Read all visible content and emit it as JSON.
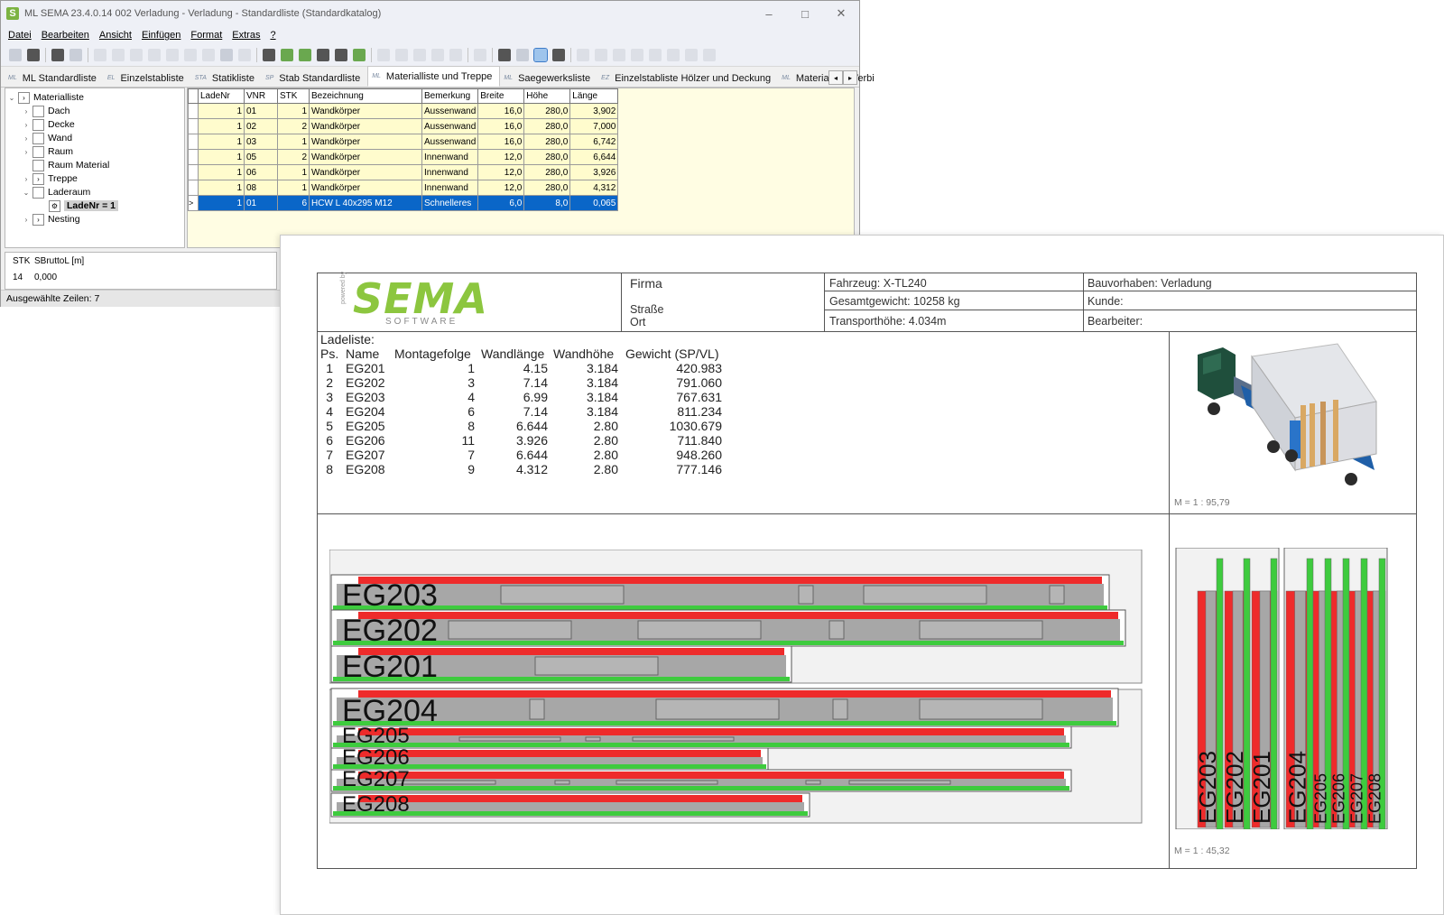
{
  "window": {
    "icon": "S",
    "title": "ML  SEMA  23.4.0.14 002 Verladung - Verladung  - Standardliste (Standardkatalog)",
    "controls": [
      "–",
      "□",
      "✕"
    ]
  },
  "menu": [
    "Datei",
    "Bearbeiten",
    "Ansicht",
    "Einfügen",
    "Format",
    "Extras",
    "?"
  ],
  "tabs": [
    {
      "icon": "ML",
      "label": "ML Standardliste"
    },
    {
      "icon": "EL",
      "label": "Einzelstabliste"
    },
    {
      "icon": "STA",
      "label": "Statikliste"
    },
    {
      "icon": "SP",
      "label": "Stab Standardliste"
    },
    {
      "icon": "ML",
      "label": "Materialliste und Treppe"
    },
    {
      "icon": "ML",
      "label": "Saegewerksliste"
    },
    {
      "icon": "EZ",
      "label": "Einzelstabliste Hölzer und Deckung"
    },
    {
      "icon": "ML",
      "label": "Materialliste Verbi"
    }
  ],
  "tab_scroll": [
    "◂",
    "▸"
  ],
  "tree": {
    "root": "Materialliste",
    "items": [
      "Dach",
      "Decke",
      "Wand",
      "Raum",
      "Raum Material",
      "Treppe",
      "Laderaum",
      "LadeNr = 1",
      "Nesting"
    ]
  },
  "grid": {
    "columns": [
      "LadeNr",
      "VNR",
      "STK",
      "Bezeichnung",
      "Bemerkung",
      "Breite",
      "Höhe",
      "Länge"
    ],
    "rows": [
      [
        "1",
        "01",
        "1",
        "Wandkörper",
        "Aussenwand",
        "16,0",
        "280,0",
        "3,902"
      ],
      [
        "1",
        "02",
        "2",
        "Wandkörper",
        "Aussenwand",
        "16,0",
        "280,0",
        "7,000"
      ],
      [
        "1",
        "03",
        "1",
        "Wandkörper",
        "Aussenwand",
        "16,0",
        "280,0",
        "6,742"
      ],
      [
        "1",
        "05",
        "2",
        "Wandkörper",
        "Innenwand",
        "12,0",
        "280,0",
        "6,644"
      ],
      [
        "1",
        "06",
        "1",
        "Wandkörper",
        "Innenwand",
        "12,0",
        "280,0",
        "3,926"
      ],
      [
        "1",
        "08",
        "1",
        "Wandkörper",
        "Innenwand",
        "12,0",
        "280,0",
        "4,312"
      ],
      [
        "1",
        "01",
        "6",
        "HCW L 40x295 M12",
        "Schnelleres",
        "6,0",
        "8,0",
        "0,065"
      ]
    ],
    "selected_row_marker": ">"
  },
  "summary": {
    "h1": "STK",
    "h2": "SBruttoL [m]",
    "v1": "14",
    "v2": "0,000"
  },
  "status": "Ausgewählte Zeilen: 7",
  "report": {
    "logo_main": "SEMA",
    "logo_sub": "SOFTWARE",
    "logo_powered": "powered by",
    "firma": "Firma",
    "strasse": "Straße",
    "ort": "Ort",
    "fahrzeug": "Fahrzeug: X-TL240",
    "gesamtgewicht": "Gesamtgewicht: 10258 kg",
    "transporthoehe": "Transporthöhe: 4.034m",
    "bauvorhaben": "Bauvorhaben: Verladung",
    "kunde": "Kunde:",
    "bearbeiter": "Bearbeiter:",
    "ladeliste_title": "Ladeliste:",
    "ladeliste_headers": [
      "Ps.",
      "Name",
      "Montagefolge",
      "Wandlänge",
      "Wandhöhe",
      "Gewicht (SP/VL)"
    ],
    "ladeliste_rows": [
      [
        "1",
        "EG201",
        "1",
        "4.15",
        "3.184",
        "420.983"
      ],
      [
        "2",
        "EG202",
        "3",
        "7.14",
        "3.184",
        "791.060"
      ],
      [
        "3",
        "EG203",
        "4",
        "6.99",
        "3.184",
        "767.631"
      ],
      [
        "4",
        "EG204",
        "6",
        "7.14",
        "3.184",
        "811.234"
      ],
      [
        "5",
        "EG205",
        "8",
        "6.644",
        "2.80",
        "1030.679"
      ],
      [
        "6",
        "EG206",
        "11",
        "3.926",
        "2.80",
        "711.840"
      ],
      [
        "7",
        "EG207",
        "7",
        "6.644",
        "2.80",
        "948.260"
      ],
      [
        "8",
        "EG208",
        "9",
        "4.312",
        "2.80",
        "777.146"
      ]
    ],
    "scale_truck": "M = 1 : 95,79",
    "scale_end": "M = 1 : 45,32",
    "stack_labels": [
      "EG203",
      "EG202",
      "EG201",
      "EG204",
      "EG205",
      "EG206",
      "EG207",
      "EG208"
    ],
    "end_labels": [
      "EG203",
      "EG202",
      "EG201",
      "EG204",
      "EG205",
      "EG206",
      "EG207",
      "EG208"
    ]
  },
  "colors": {
    "wall_red": "#ee2b2b",
    "wall_green": "#3ecb3e",
    "wall_grey": "#a7a7a7",
    "logo_green": "#8cc63f",
    "selection": "#0a66c8"
  }
}
